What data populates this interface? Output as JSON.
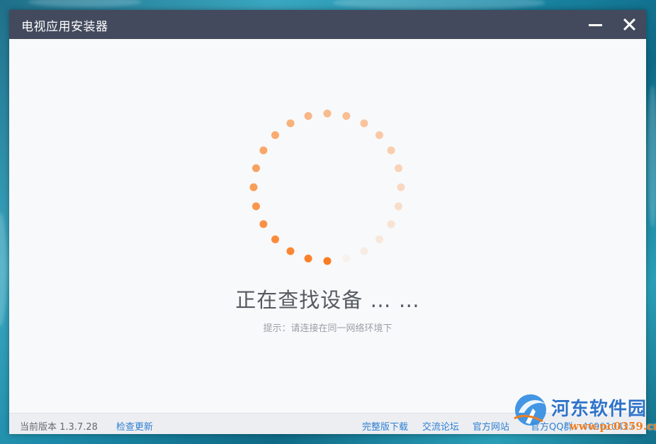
{
  "window": {
    "title": "电视应用安装器",
    "minimize_icon": "minimize-icon",
    "close_icon": "close-icon"
  },
  "main": {
    "status_text": "正在查找设备 … …",
    "hint_text": "提示：请连接在同一网络环境下",
    "spinner": {
      "dot_count": 24,
      "accent_color": "#fa7d22"
    }
  },
  "footer": {
    "version_label": "当前版本 1.3.7.28",
    "check_update": "检查更新",
    "full_download": "完整版下载",
    "forum": "交流论坛",
    "website": "官方网站",
    "qq_group": "官方QQ群：469010427"
  },
  "watermark": {
    "name": "河东软件园",
    "url": "www.pc0359.cn"
  },
  "colors": {
    "titlebar": "#434a5d",
    "content_bg": "#f8f9fa",
    "link": "#2f7fd1",
    "accent": "#fa7d22"
  }
}
